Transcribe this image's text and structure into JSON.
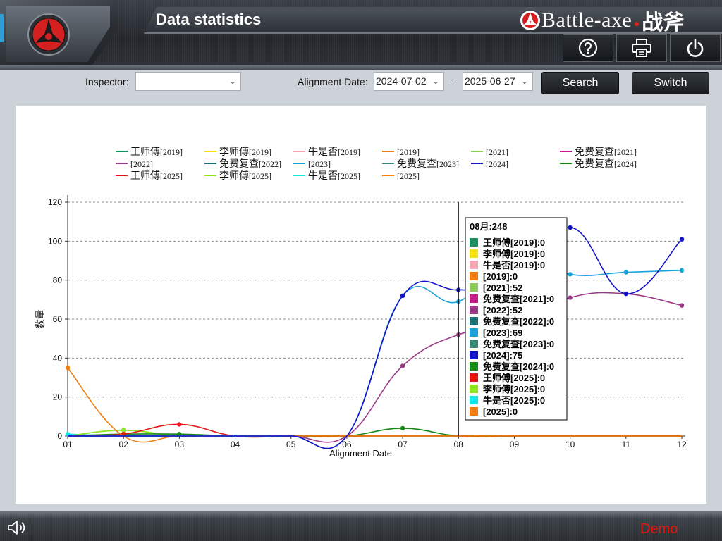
{
  "header": {
    "title": "Data statistics",
    "brand": "Battle-axe",
    "brand_cn": "战斧",
    "help_icon": "question-circle-icon",
    "print_icon": "printer-icon",
    "power_icon": "power-icon"
  },
  "filters": {
    "inspector_label": "Inspector:",
    "inspector_value": "",
    "date_label": "Alignment Date:",
    "date_start": "2024-07-02",
    "date_separator": "-",
    "date_end": "2025-06-27",
    "search_label": "Search",
    "switch_label": "Switch"
  },
  "footer": {
    "demo_label": "Demo",
    "speaker_icon": "speaker-icon"
  },
  "colors": {
    "accent_blue": "#2f9fd6",
    "brand_red": "#e0251b",
    "demo_red": "#e0150f"
  },
  "chart_data": {
    "type": "line",
    "title": "",
    "xlabel": "Alignment Date",
    "ylabel": "数量",
    "categories": [
      "01",
      "02",
      "03",
      "04",
      "05",
      "06",
      "07",
      "08",
      "09",
      "10",
      "11",
      "12"
    ],
    "ylim": [
      0,
      120
    ],
    "yticks": [
      0,
      20,
      40,
      60,
      80,
      100,
      120
    ],
    "grid": "horizontal dashed",
    "legend_position": "top",
    "series": [
      {
        "name": "王师傅",
        "year": "[2019]",
        "color": "#1b8f5e",
        "values": [
          0,
          0,
          0,
          0,
          0,
          0,
          0,
          0,
          0,
          0,
          0,
          0
        ]
      },
      {
        "name": "李师傅",
        "year": "[2019]",
        "color": "#f2e30e",
        "values": [
          0,
          0,
          0,
          0,
          0,
          0,
          0,
          0,
          0,
          0,
          0,
          0
        ]
      },
      {
        "name": "牛是否",
        "year": "[2019]",
        "color": "#f2a7b2",
        "values": [
          0,
          0,
          0,
          0,
          0,
          0,
          0,
          0,
          0,
          0,
          0,
          0
        ]
      },
      {
        "name": "",
        "year": "[2019]",
        "color": "#f07d11",
        "values": [
          0,
          0,
          0,
          0,
          0,
          0,
          0,
          0,
          0,
          0,
          0,
          0
        ]
      },
      {
        "name": "",
        "year": "[2021]",
        "color": "#8ec95b",
        "values": [
          0,
          3,
          0,
          0,
          0,
          0,
          0,
          0,
          0,
          0,
          0,
          0
        ]
      },
      {
        "name": "免费复查",
        "year": "[2021]",
        "color": "#c21b86",
        "values": [
          0,
          0,
          0,
          0,
          0,
          0,
          0,
          0,
          0,
          0,
          0,
          0
        ]
      },
      {
        "name": "",
        "year": "[2022]",
        "color": "#9b3a87",
        "values": [
          0,
          0,
          0,
          0,
          0,
          0,
          36,
          52,
          57,
          71,
          73,
          67
        ]
      },
      {
        "name": "免费复查",
        "year": "[2022]",
        "color": "#186e74",
        "values": [
          0,
          0,
          0,
          0,
          0,
          0,
          0,
          0,
          0,
          0,
          0,
          0
        ]
      },
      {
        "name": "",
        "year": "[2023]",
        "color": "#1aa3d9",
        "values": [
          0,
          0,
          0,
          0,
          0,
          0,
          72,
          69,
          93,
          83,
          84,
          85
        ]
      },
      {
        "name": "免费复查",
        "year": "[2023]",
        "color": "#3a8577",
        "values": [
          0,
          0,
          0,
          0,
          0,
          0,
          0,
          0,
          0,
          0,
          0,
          0
        ]
      },
      {
        "name": "",
        "year": "[2024]",
        "color": "#1414c8",
        "values": [
          0,
          0,
          0,
          0,
          0,
          0,
          72,
          75,
          75,
          107,
          73,
          101
        ]
      },
      {
        "name": "免费复查",
        "year": "[2024]",
        "color": "#148a14",
        "values": [
          0,
          1,
          1,
          0,
          0,
          0,
          4,
          0,
          0,
          0,
          0,
          0
        ]
      },
      {
        "name": "王师傅",
        "year": "[2025]",
        "color": "#e61414",
        "values": [
          0,
          1,
          6,
          0,
          0,
          0,
          0,
          0,
          0,
          0,
          0,
          0
        ]
      },
      {
        "name": "李师傅",
        "year": "[2025]",
        "color": "#8ee61e",
        "values": [
          0,
          3,
          0,
          0,
          0,
          0,
          0,
          0,
          0,
          0,
          0,
          0
        ]
      },
      {
        "name": "牛是否",
        "year": "[2025]",
        "color": "#14e6e6",
        "values": [
          1,
          0,
          0,
          0,
          0,
          0,
          0,
          0,
          0,
          0,
          0,
          0
        ]
      },
      {
        "name": "",
        "year": "[2025]",
        "color": "#f07d11",
        "values": [
          35,
          0,
          0,
          0,
          0,
          0,
          0,
          0,
          0,
          0,
          0,
          0
        ]
      }
    ],
    "tooltip": {
      "category_index": 7,
      "title": "08月:248",
      "lines": [
        "王师傅[2019]:0",
        "李师傅[2019]:0",
        "牛是否[2019]:0",
        "[2019]:0",
        "[2021]:52",
        "免费复查[2021]:0",
        "[2022]:52",
        "免费复查[2022]:0",
        "[2023]:69",
        "免费复查[2023]:0",
        "[2024]:75",
        "免费复查[2024]:0",
        "王师傅[2025]:0",
        "李师傅[2025]:0",
        "牛是否[2025]:0",
        "[2025]:0"
      ]
    }
  }
}
